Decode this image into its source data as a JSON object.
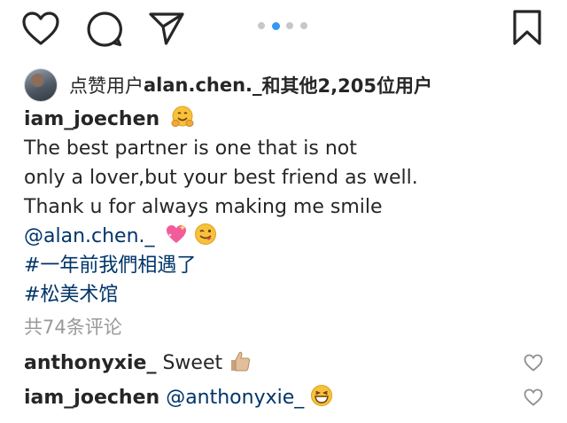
{
  "actions": {
    "like_icon": "heart-outline",
    "comment_icon": "speech-bubble",
    "share_icon": "paper-plane",
    "save_icon": "bookmark-outline"
  },
  "carousel": {
    "count": 3,
    "active_index": 1
  },
  "likes": {
    "prefix": "点赞用户 ",
    "username": "alan.chen._",
    "suffix": "和其他2,205位用户"
  },
  "caption": {
    "username": "iam_joechen",
    "line1": "The best partner is one that is not",
    "line2": "only a lover,but your best friend as well.",
    "line3": "Thank u for always making me smile",
    "mention": "@alan.chen._",
    "hashtag1": "#一年前我們相遇了",
    "hashtag2": "#松美术馆"
  },
  "view_comments": "共74条评论",
  "comments": [
    {
      "username": "anthonyxie_",
      "text": "Sweet"
    },
    {
      "username": "iam_joechen",
      "mention": "@anthonyxie_"
    }
  ],
  "colors": {
    "text": "#262626",
    "link": "#003569",
    "muted": "#999999",
    "carousel_active": "#3897f0",
    "carousel_inactive": "#c7c7c7"
  }
}
